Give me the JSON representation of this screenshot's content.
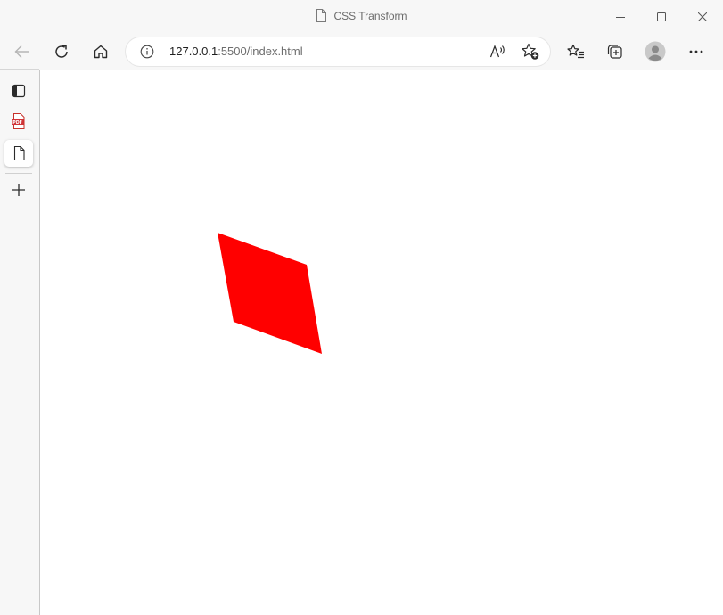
{
  "window": {
    "title": "CSS Transform"
  },
  "toolbar": {
    "url_host": "127.0.0.1",
    "url_rest": ":5500/index.html"
  },
  "page": {
    "shape_color": "#ff0000",
    "background": "#ffffff"
  },
  "icons": {
    "title": "page-icon",
    "minimize": "minimize-icon",
    "maximize": "maximize-icon",
    "close": "close-icon",
    "back": "back-arrow-icon",
    "refresh": "refresh-icon",
    "home": "home-icon",
    "info": "info-icon",
    "read_aloud": "read-aloud-icon",
    "add_favorite": "add-favorite-icon",
    "favorites": "favorites-icon",
    "collections": "collections-icon",
    "profile": "profile-icon",
    "more": "more-icon",
    "tab_actions": "tab-actions-icon",
    "pdf_tab": "pdf-icon",
    "page_tab": "page-icon",
    "new_tab": "plus-icon"
  }
}
